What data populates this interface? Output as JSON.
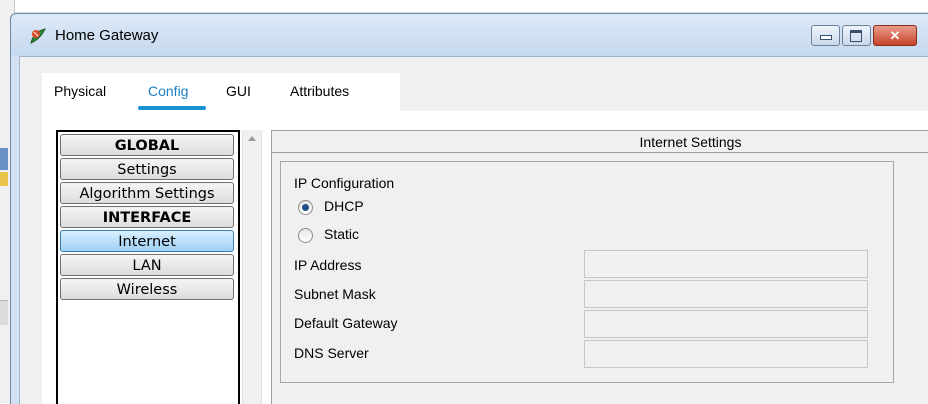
{
  "window": {
    "title": "Home Gateway",
    "controls": {
      "minimize": "minimize",
      "maximize": "maximize",
      "close": "✕"
    }
  },
  "tabs": [
    {
      "label": "Physical",
      "active": false
    },
    {
      "label": "Config",
      "active": true
    },
    {
      "label": "GUI",
      "active": false
    },
    {
      "label": "Attributes",
      "active": false
    }
  ],
  "sidebar": {
    "items": [
      {
        "label": "GLOBAL",
        "type": "header"
      },
      {
        "label": "Settings",
        "type": "item"
      },
      {
        "label": "Algorithm Settings",
        "type": "item"
      },
      {
        "label": "INTERFACE",
        "type": "header"
      },
      {
        "label": "Internet",
        "type": "item",
        "selected": true
      },
      {
        "label": "LAN",
        "type": "item"
      },
      {
        "label": "Wireless",
        "type": "item"
      }
    ]
  },
  "internet_settings": {
    "title": "Internet Settings",
    "ip_configuration_label": "IP Configuration",
    "options": [
      {
        "label": "DHCP",
        "checked": true
      },
      {
        "label": "Static",
        "checked": false
      }
    ],
    "fields": [
      {
        "label": "IP Address",
        "value": ""
      },
      {
        "label": "Subnet Mask",
        "value": ""
      },
      {
        "label": "Default Gateway",
        "value": ""
      },
      {
        "label": "DNS Server",
        "value": ""
      }
    ]
  },
  "colors": {
    "accent": "#1b90d4",
    "selected_item": "#9fd0f5",
    "titlebar": "#d3e2f3",
    "close_button": "#c5432a"
  }
}
